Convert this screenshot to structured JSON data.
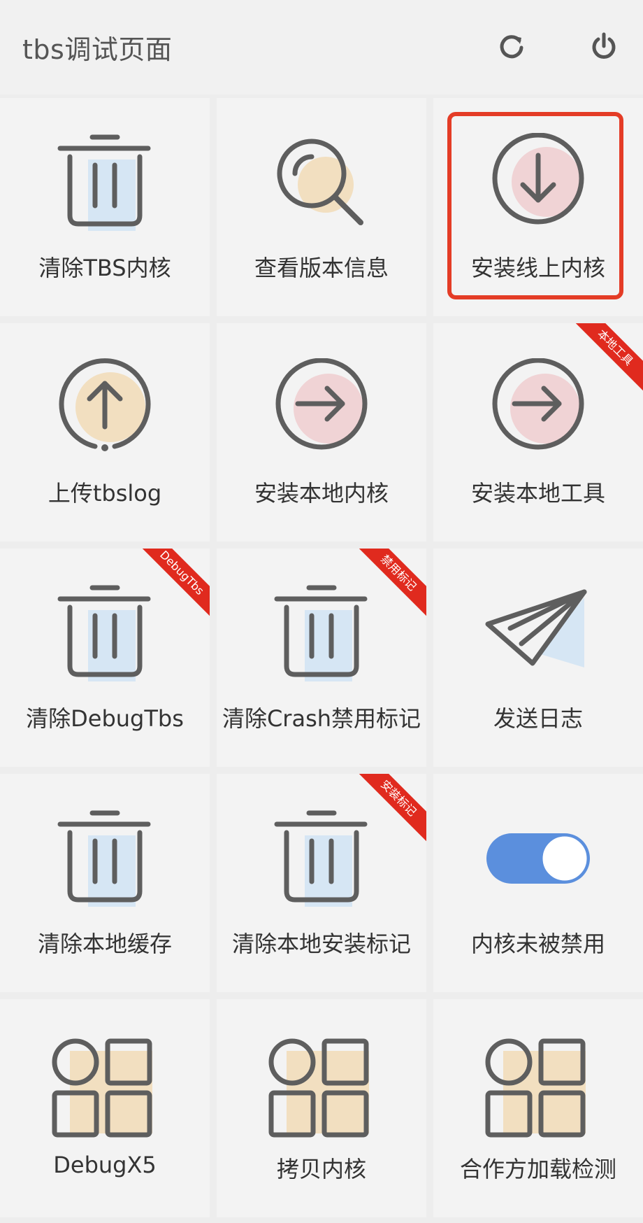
{
  "header": {
    "title": "tbs调试页面",
    "icons": {
      "refresh": "refresh-icon",
      "power": "power-icon"
    }
  },
  "colors": {
    "accent_blue": "#5b8fdd",
    "tint_blue": "#d6e6f4",
    "tint_peach": "#f2dfc0",
    "tint_pink": "#f0d3d5",
    "ribbon_red": "#e02a1e",
    "highlight_red": "#e43c26"
  },
  "tiles": [
    {
      "label": "清除TBS内核",
      "icon": "trash-icon"
    },
    {
      "label": "查看版本信息",
      "icon": "magnifier-icon"
    },
    {
      "label": "安装线上内核",
      "icon": "download-circle-icon",
      "highlighted": true
    },
    {
      "label": "上传tbslog",
      "icon": "upload-circle-icon"
    },
    {
      "label": "安装本地内核",
      "icon": "arrow-right-circle-icon"
    },
    {
      "label": "安装本地工具",
      "icon": "arrow-right-circle-icon",
      "ribbon": "本地工具"
    },
    {
      "label": "清除DebugTbs",
      "icon": "trash-icon",
      "ribbon": "DebugTbs"
    },
    {
      "label": "清除Crash禁用标记",
      "icon": "trash-icon",
      "ribbon": "禁用标记"
    },
    {
      "label": "发送日志",
      "icon": "paper-plane-icon"
    },
    {
      "label": "清除本地缓存",
      "icon": "trash-icon"
    },
    {
      "label": "清除本地安装标记",
      "icon": "trash-icon",
      "ribbon": "安装标记"
    },
    {
      "label": "内核未被禁用",
      "icon": "toggle-switch",
      "toggle_on": true
    },
    {
      "label": "DebugX5",
      "icon": "grid-apps-icon"
    },
    {
      "label": "拷贝内核",
      "icon": "grid-apps-icon"
    },
    {
      "label": "合作方加载检测",
      "icon": "grid-apps-icon"
    }
  ]
}
